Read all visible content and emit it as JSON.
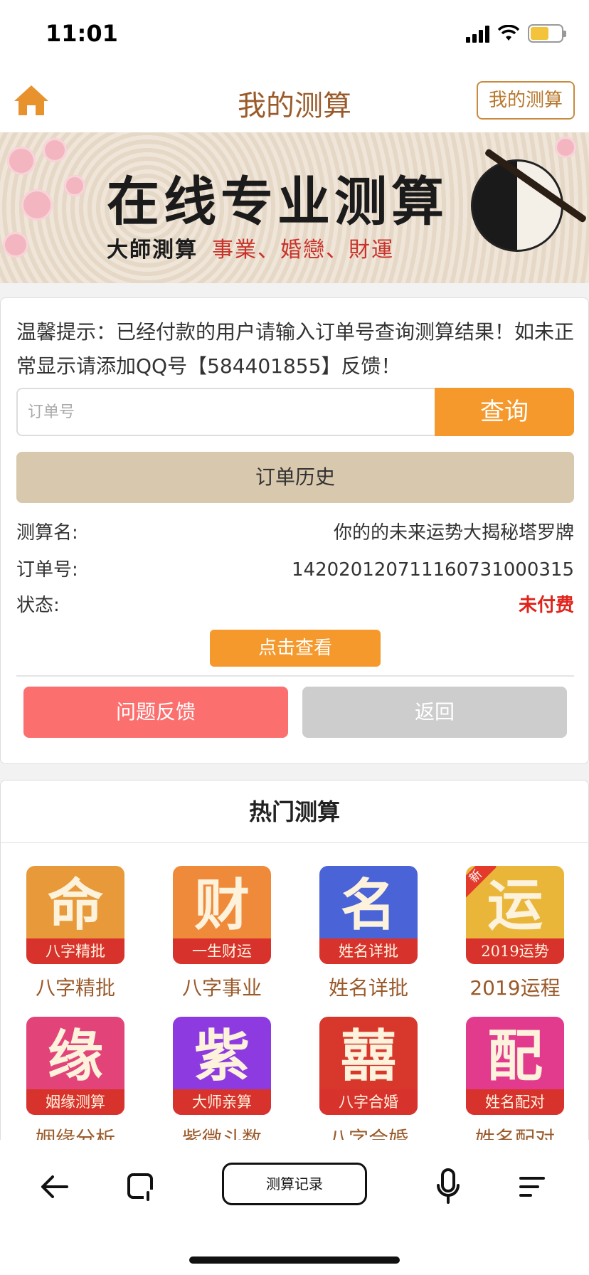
{
  "status_bar": {
    "time": "11:01"
  },
  "header": {
    "title": "我的测算",
    "right_button": "我的测算"
  },
  "banner": {
    "title": "在线专业测算",
    "subtitle_dark": "大師測算",
    "subtitle_red": "事業、婚戀、財運"
  },
  "query_card": {
    "tip": "温馨提示：已经付款的用户请输入订单号查询测算结果！如未正常显示请添加QQ号【584401855】反馈！",
    "order_input": {
      "value": "",
      "placeholder": "订单号"
    },
    "query_button": "查询",
    "history_button": "订单历史",
    "rows": [
      {
        "label": "测算名:",
        "value": "你的的未来运势大揭秘塔罗牌"
      },
      {
        "label": "订单号:",
        "value": "14202012071116073100031​5"
      },
      {
        "label": "状态:",
        "value": "未付费"
      }
    ],
    "view_button": "点击查看",
    "feedback_button": "问题反馈",
    "back_button": "返回"
  },
  "hot": {
    "title": "热门测算",
    "items": [
      {
        "char": "命",
        "ribbon": "八字精批",
        "label": "八字精批",
        "color": "#e89a3a"
      },
      {
        "char": "财",
        "ribbon": "一生财运",
        "label": "八字事业",
        "color": "#ef8a3a"
      },
      {
        "char": "名",
        "ribbon": "姓名详批",
        "label": "姓名详批",
        "color": "#4a63d6"
      },
      {
        "char": "运",
        "ribbon": "2019运势",
        "label": "2019运程",
        "color": "#e9b63a",
        "badge": "新"
      },
      {
        "char": "缘",
        "ribbon": "姻缘测算",
        "label": "姻缘分析",
        "color": "#e2447a"
      },
      {
        "char": "紫",
        "ribbon": "大师亲算",
        "label": "紫微斗数",
        "color": "#8d3ae0"
      },
      {
        "char": "囍",
        "ribbon": "八字合婚",
        "label": "八字合婚",
        "color": "#d8382c"
      },
      {
        "char": "配",
        "ribbon": "姓名配对",
        "label": "姓名配对",
        "color": "#e23a8d"
      }
    ]
  },
  "bottom_bar": {
    "record_button": "测算记录"
  },
  "colors": {
    "accent": "#f5992c",
    "brown": "#9a5a2a",
    "red": "#e0241b"
  }
}
